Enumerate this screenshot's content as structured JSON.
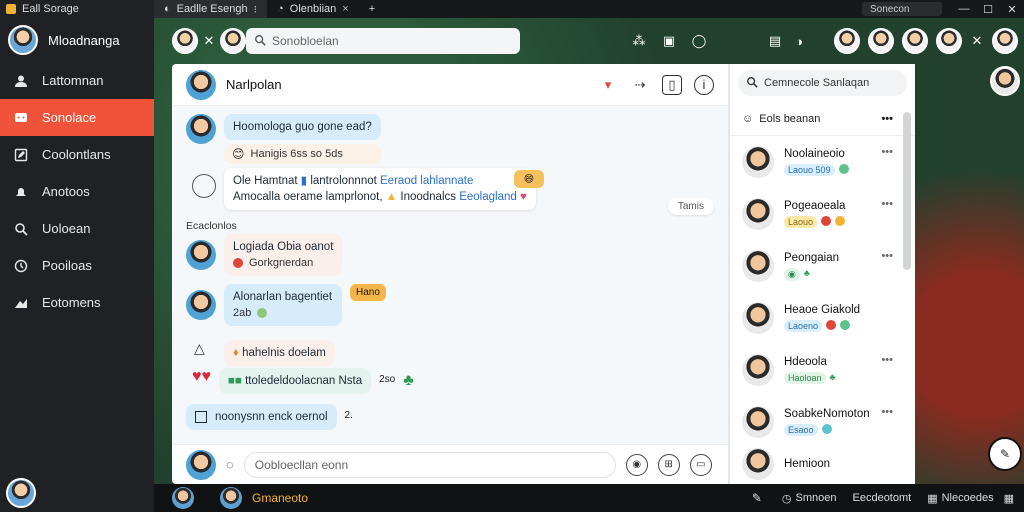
{
  "app": {
    "title": "Eall Sorage"
  },
  "tabs": [
    {
      "label": "Eadlle Esengh",
      "close": "⁝"
    },
    {
      "label": "Olenbiian",
      "close": "×"
    }
  ],
  "window": {
    "search_label": "Sonecon"
  },
  "sidebar": {
    "profile_name": "Mloadnanga",
    "items": [
      {
        "label": "Lattomnan",
        "icon": "person-icon"
      },
      {
        "label": "Sonolace",
        "icon": "chat-icon"
      },
      {
        "label": "Coolontlans",
        "icon": "edit-icon"
      },
      {
        "label": "Anotoos",
        "icon": "bell-icon"
      },
      {
        "label": "Uoloean",
        "icon": "search-icon"
      },
      {
        "label": "Pooiloas",
        "icon": "clock-icon"
      },
      {
        "label": "Eotomens",
        "icon": "settings-icon"
      }
    ]
  },
  "toolbar": {
    "search_placeholder": "Sonobloelan"
  },
  "chat": {
    "title": "Narlpolan",
    "section_label": "Ecaclonlos",
    "time_chip": "Tamis",
    "messages": [
      {
        "text": "Hoomologa guo gone ead?",
        "sub": "Hanigis   6ss   so   5ds"
      },
      {
        "line1a": "Ole Hamtnat",
        "line1b": "lantrolonnnot",
        "line1c": "Eeraod lahlannate",
        "line2a": "Amocalla oerame lamprlonot,",
        "line2b": "Inoodnalcs",
        "line2c": "Eeolagland"
      },
      {
        "text": "Logiada Obia oanot",
        "sub": "Gorkgnerdan"
      },
      {
        "text": "Alonarlan bagentiet",
        "sub": "2ab",
        "badge": "Hano"
      },
      {
        "text": "hahelnis doelam"
      },
      {
        "text": "ttoledeldoolacnan Nsta",
        "sub": "2so"
      },
      {
        "text": "noonysnn enck oernol",
        "sub": "2."
      }
    ],
    "composer_placeholder": "Oobloecllan eonn"
  },
  "contacts": {
    "search_placeholder": "Cemnecole Sanlaqan",
    "header": "Eols beanan",
    "list": [
      {
        "name": "Noolaineoio",
        "meta": "Laouo   509",
        "pill": "blue"
      },
      {
        "name": "Pogeaoeala",
        "meta": "Laouo",
        "pill": "yellow"
      },
      {
        "name": "Peongaian",
        "meta": "",
        "pill": "green"
      },
      {
        "name": "Heaoe Giakold",
        "meta": "Laoeno",
        "pill": "blue"
      },
      {
        "name": "Hdeoola",
        "meta": "Haoloan",
        "pill": "green"
      },
      {
        "name": "SoabkeNomoton",
        "meta": "Esaoo",
        "pill": "blue"
      },
      {
        "name": "Hemioon",
        "meta": "",
        "pill": "blue"
      }
    ]
  },
  "bottombar": {
    "chat_name": "Gmaneoto",
    "item1": "Smnoen",
    "item2": "Eecdeotomt",
    "item3": "Nlecoedes"
  },
  "colors": {
    "accent": "#f0533a",
    "bubble_blue": "#d6ecfb",
    "gold": "#f2b233"
  }
}
